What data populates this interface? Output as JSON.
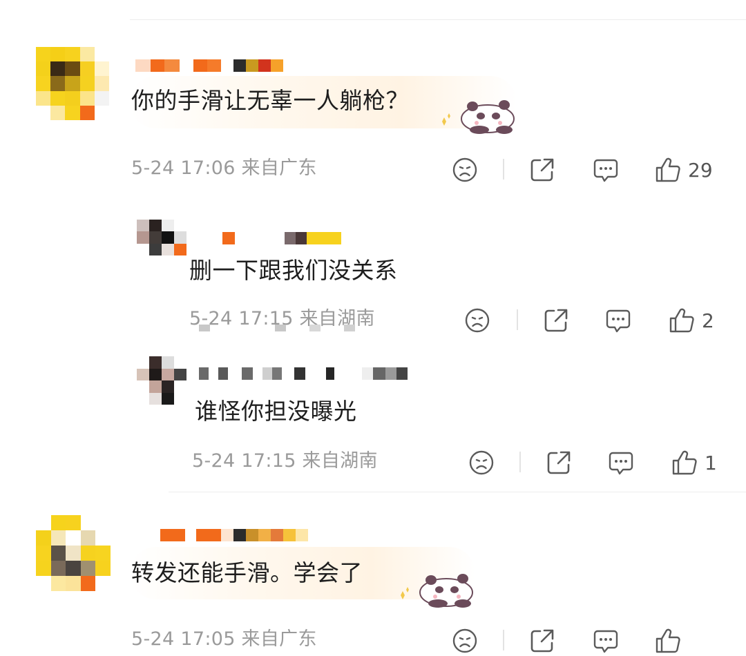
{
  "comments": [
    {
      "text": "你的手滑让无辜一人躺枪？",
      "meta": "5-24 17:06 来自广东",
      "like_count": "29"
    },
    {
      "text": "删一下跟我们没关系",
      "meta": "5-24 17:15 来自湖南",
      "like_count": "2"
    },
    {
      "text": "谁怪你担没曝光",
      "meta": "5-24 17:15 来自湖南",
      "like_count": "1"
    },
    {
      "text": "转发还能手滑。学会了",
      "meta": "5-24 17:05 来自广东",
      "like_count": ""
    }
  ],
  "icons": [
    "dislike-icon",
    "share-icon",
    "comment-icon",
    "like-icon",
    "panda-sticker"
  ],
  "colors": {
    "meta_text": "#9a9a9a",
    "body_text": "#1e1e1e",
    "icon_stroke": "#5a5a5a",
    "pixel_orange": "#f26a1b",
    "pixel_yellow": "#f7d21e"
  }
}
